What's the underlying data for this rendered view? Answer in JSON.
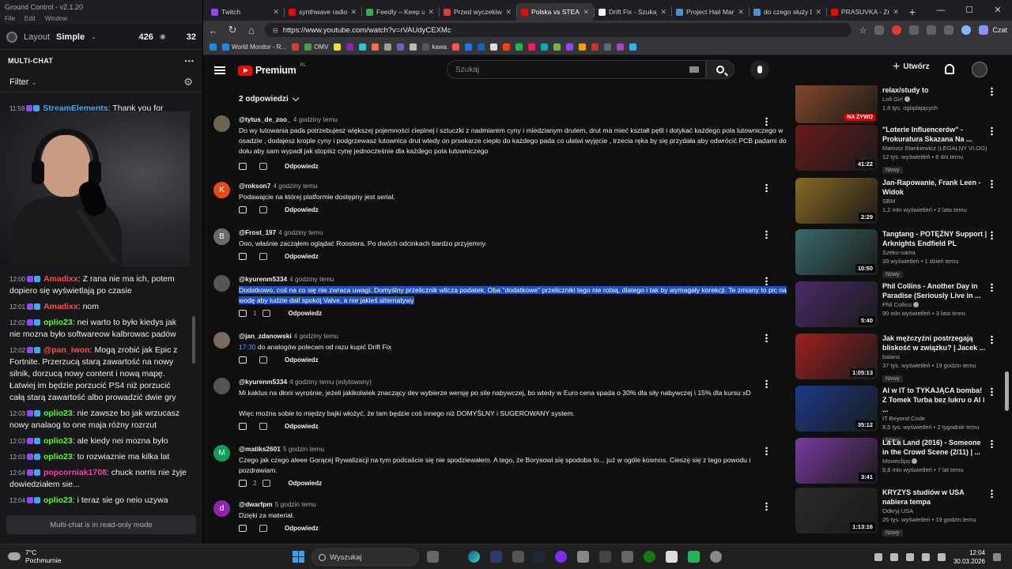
{
  "gc": {
    "title": "Ground Control - v2.1.20",
    "menu": [
      "File",
      "Edit",
      "Window"
    ],
    "layout_label": "Layout",
    "layout_value": "Simple",
    "viewers": "426",
    "viewers_2": "32",
    "multichat_title": "MULTI-CHAT",
    "filter_label": "Filter",
    "readonly_note": "Multi-chat is in read-only mode",
    "messages": [
      {
        "time": "11:59",
        "user": "StreamElements",
        "color": "#3ea6ff",
        "text": "Thank you for"
      },
      {
        "time": "12:00",
        "user": "Amadixx",
        "color": "#ff4d4d",
        "text": "Z rana nie ma ich, potem dopiero się wyświetlają po czasie"
      },
      {
        "time": "12:01",
        "user": "Amadixx",
        "color": "#ff4d4d",
        "text": "nom"
      },
      {
        "time": "12:02",
        "user": "oplio23",
        "color": "#53fc18",
        "text": "nei warto to było kiedys jak nie mozna było softwareow kalbrowac padów"
      },
      {
        "time": "12:02",
        "user": "@pan_iwon",
        "color": "#ff4d4d",
        "text": "Mogą zrobić jak Epic z Fortnite. Przerzucą starą zawartość na nowy silnik, dorzucą nowy content i nową mapę. Łatwiej im będzie porzucić PS4 niż porzucić całą starą zawartość albo prowadzić dwie gry"
      },
      {
        "time": "12:03",
        "user": "oplio23",
        "color": "#53fc18",
        "text": "nie zawsze bo jak wrzucasz nowy analaog to one maja różny rozrzut"
      },
      {
        "time": "12:03",
        "user": "oplio23",
        "color": "#53fc18",
        "text": "ale kiedy nei mozna było"
      },
      {
        "time": "12:03",
        "user": "oplio23",
        "color": "#53fc18",
        "text": "to rozwiaznie ma kilka lat"
      },
      {
        "time": "12:04",
        "user": "popcorniak1708",
        "color": "#ff3ea5",
        "text": "chuck norris nie żyje dowiedziałem sie..."
      },
      {
        "time": "12:04",
        "user": "oplio23",
        "color": "#53fc18",
        "text": "i teraz sie go neio uzywa"
      }
    ]
  },
  "browser": {
    "tabs": [
      {
        "label": "Twitch",
        "color": "#9146ff"
      },
      {
        "label": "synthwave radio",
        "color": "#ff0000"
      },
      {
        "label": "Feedly – Keep up w",
        "color": "#2bb24c"
      },
      {
        "label": "Przed wyczekiwaną",
        "color": "#e53935"
      },
      {
        "label": "Polska vs STEAM",
        "color": "#ff0000",
        "active": true
      },
      {
        "label": "Drift Fix - Szukaj w",
        "color": "#ffffff"
      },
      {
        "label": "Project Hail Mary",
        "color": "#4a90d9"
      },
      {
        "label": "do czego służy Dri",
        "color": "#4a90d9"
      },
      {
        "label": "PRASUVKA - Zmia",
        "color": "#ff0000"
      }
    ],
    "url": "https://www.youtube.com/watch?v=rVAUdyCEXMc",
    "czat_label": "Czat",
    "bookmarks": [
      "World Monitor - R...",
      "OMV",
      "kawa"
    ]
  },
  "yt": {
    "logo_text": "Premium",
    "logo_region": "PL",
    "search_placeholder": "Szukaj",
    "create_label": "Utwórz",
    "replies_toggle": "2 odpowiedzi",
    "reply_label": "Odpowiedz",
    "comments": [
      {
        "user": "@tytus_de_zoo_",
        "ago": "4 godziny temu",
        "avatar_letter": "",
        "avatar_color": "#6d6550",
        "text": "Do wy lutowania pada potrzebujesz większej pojemności cieplnej i sztuczki z nadmiarem cyny i miedzianym drutem, drut ma mieć kształt pętli i dotykać każdego pola lutowniczego w osadzie , dodajesz krople cyny i podgrzewasz lutownica drut wtedy on prsekarze ciepło do każdego pada co ułatwi wyjęcie , trzecia ręka by się przydała aby odwrócić PCB padami do dołu aby sam wypadł jak stopisz cynę jednocześnie dla każdego pola lutowniczego",
        "likes": ""
      },
      {
        "user": "@rokson7",
        "ago": "4 godziny temu",
        "avatar_letter": "K",
        "avatar_color": "#e64a19",
        "text": "Podawajcie na której platformie dostępny jest serial.",
        "likes": ""
      },
      {
        "user": "@Frost_197",
        "ago": "4 godziny temu",
        "avatar_letter": "B",
        "avatar_color": "#6b6b6b",
        "text": "Ooo, właśnie zacząłem oglądać Roostera. Po dwóch odcinkach bardzo przyjemny.",
        "likes": ""
      },
      {
        "user": "@kyurenm5334",
        "ago": "4 godziny temu",
        "avatar_letter": "",
        "avatar_color": "#555555",
        "text": "Dodatkowo, coś na co się nie zwraca uwagi. Domyślny przelicznik wlicza podatek. Oba \"dodatkowe\" przeliczniki tego nie robią, dlatego i tak by wymagały korekcji. Te zmiany to pic na wodę aby ludzie dali spokój Valve, a nie jakieś alternatywy",
        "likes": "1",
        "highlight": true
      },
      {
        "user": "@jan_zdanowski",
        "ago": "4 godziny temu",
        "avatar_letter": "",
        "avatar_color": "#7a6a60",
        "timestamp": "17:30",
        "text": " do analogów polecam od razu kupić Drift Fix",
        "likes": ""
      },
      {
        "user": "@kyurenm5334",
        "ago": "4 godziny temu (edytowany)",
        "avatar_letter": "",
        "avatar_color": "#555555",
        "text": "Mi kaktus na dłoni wyrośnie, jeżeli jakikolwiek znaczący dev wybierze wersję po sile nabywczej, bo wtedy w Euro cena spada o 30% dla siły nabywczej i 15% dla kursu xD",
        "text2": "Więc można sobie to między bajki włożyć, że tam będzie coś innego niż DOMYŚLNY i SUGEROWANY system.",
        "likes": ""
      },
      {
        "user": "@matiks2601",
        "ago": "5 godzin temu",
        "avatar_letter": "M",
        "avatar_color": "#0f9d58",
        "text": "Czego jak czego aleee Gorącej Rywalizacji na tym podcaście się nie spodziewałem. A tego, że Borysowi się spodoba to... już w ogóle kosmos. Cieszę się z tego powodu i pozdrawiam.",
        "likes": "2"
      },
      {
        "user": "@dwarfpm",
        "ago": "5 godzin temu",
        "avatar_letter": "d",
        "avatar_color": "#8e24aa",
        "text": "Dzięki za materiał.",
        "likes": ""
      }
    ],
    "recs": [
      {
        "title": "relax/study to",
        "channel": "Lofi Girl",
        "verified": true,
        "stats": "1,6 tys. oglądających",
        "badge": "NA ŻYWO",
        "live": true,
        "thumb": "#8a4a2a",
        "new": false
      },
      {
        "title": "\"Loterie Influencerów\" - Prokuratura Skazana Na ...",
        "channel": "Mariusz Stankiewicz (LEGALNY VLOG)",
        "verified": false,
        "stats": "12 tys. wyświetleń • 6 dni temu",
        "badge": "41:22",
        "thumb": "#6a1a1a",
        "new": true
      },
      {
        "title": "Jan-Rapowanie, Frank Leen - Widok",
        "channel": "SBM",
        "verified": false,
        "stats": "1,2 mln wyświetleń • 2 lata temu",
        "badge": "2:29",
        "thumb": "#8a6a20",
        "new": false
      },
      {
        "title": "Tangtang - POTĘŻNY Support | Arknights Endfield PL",
        "channel": "Szeku-sama",
        "verified": false,
        "stats": "39 wyświetleń • 1 dzień temu",
        "badge": "10:50",
        "thumb": "#3a6a6a",
        "new": true
      },
      {
        "title": "Phil Collins - Another Day in Paradise (Seriously Live in ...",
        "channel": "Phil Collins",
        "verified": true,
        "stats": "90 mln wyświetleń • 3 lata temu",
        "badge": "5:40",
        "thumb": "#4a2a6a",
        "new": false
      },
      {
        "title": "Jak mężczyźni postrzegają bliskość w związku? | Jacek ...",
        "channel": "balans",
        "verified": false,
        "stats": "37 tys. wyświetleń • 19 godzin temu",
        "badge": "1:05:13",
        "thumb": "#a02020",
        "new": true
      },
      {
        "title": "AI w IT to TYKAJĄCA bomba! Z Tomek Turba bez lukru o AI i ...",
        "channel": "IT Beyond Code",
        "verified": false,
        "stats": "8,5 tys. wyświetleń • 2 tygodnie temu",
        "badge": "35:12",
        "thumb": "#1a3a8a",
        "new": true
      },
      {
        "title": "La La Land (2016) - Someone in the Crowd Scene (2/11) | ...",
        "channel": "Movieclips",
        "verified": true,
        "stats": "9,8 mln wyświetleń • 7 lat temu",
        "badge": "3:41",
        "thumb": "#7a3aa0",
        "new": false
      },
      {
        "title": "KRYZYS studiów w USA nabiera tempa",
        "channel": "Odkryj USA",
        "verified": false,
        "stats": "26 tys. wyświetleń • 19 godzin temu",
        "badge": "1:13:16",
        "thumb": "#2a2a2a",
        "new": true
      }
    ]
  },
  "taskbar": {
    "temp": "7°C",
    "weather": "Pochmurnie",
    "search": "Wyszukaj",
    "time": "12:04",
    "date": "30.03.2026"
  }
}
